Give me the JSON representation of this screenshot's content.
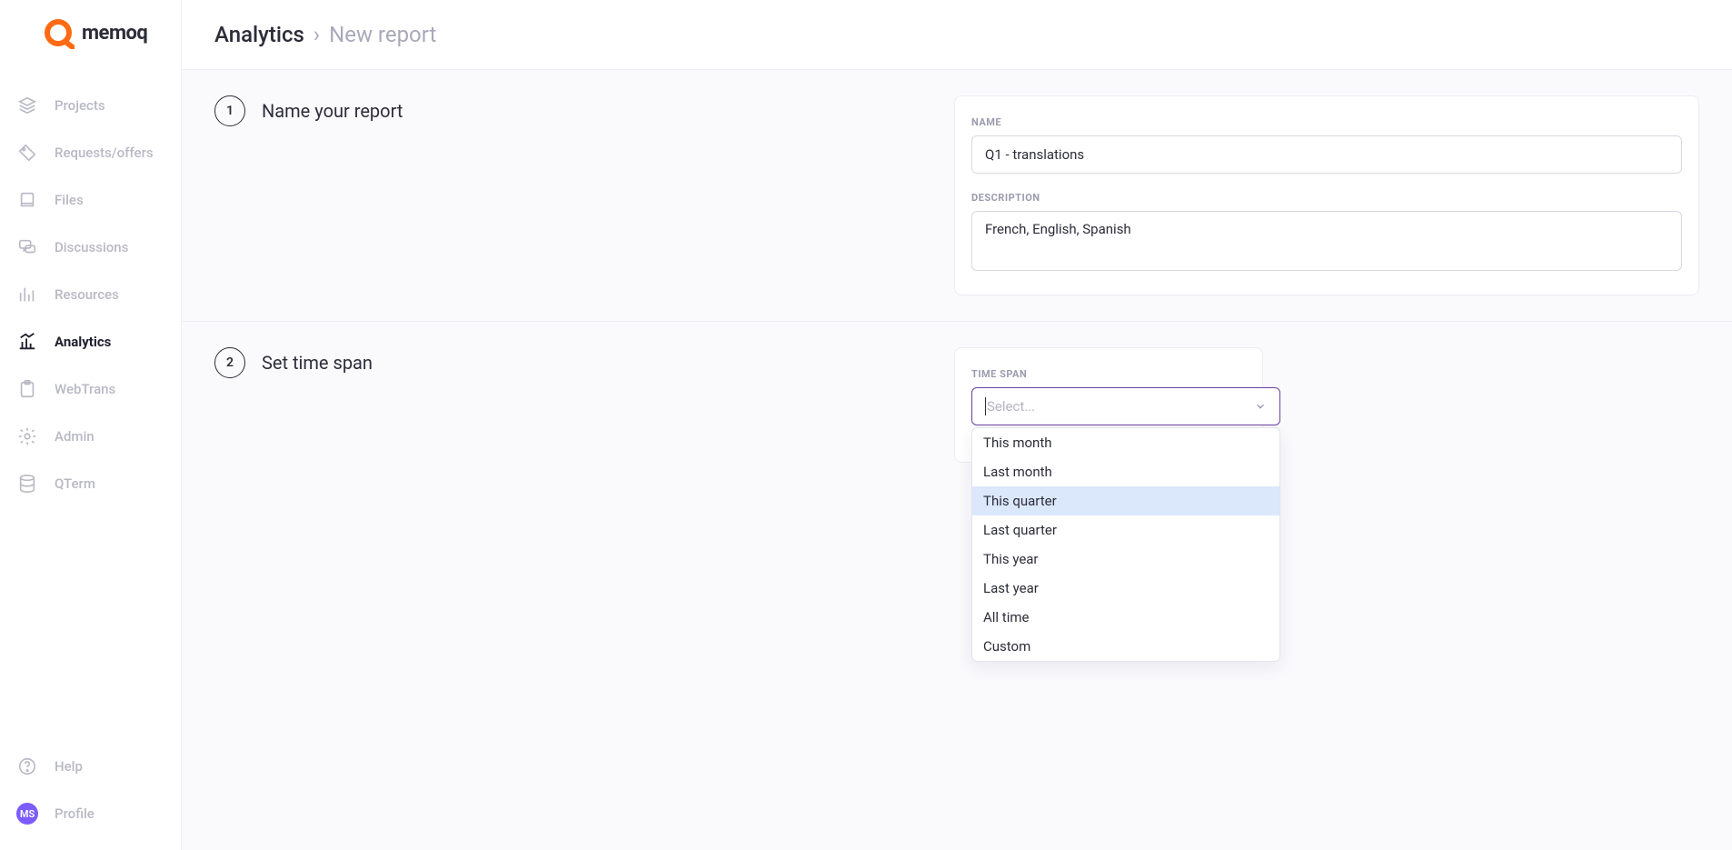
{
  "brand": "memoq",
  "breadcrumb": {
    "root": "Analytics",
    "sep": "›",
    "current": "New report"
  },
  "sidebar": {
    "items": [
      {
        "label": "Projects",
        "icon": "stack"
      },
      {
        "label": "Requests/offers",
        "icon": "tag"
      },
      {
        "label": "Files",
        "icon": "folders"
      },
      {
        "label": "Discussions",
        "icon": "chat"
      },
      {
        "label": "Resources",
        "icon": "bars"
      },
      {
        "label": "Analytics",
        "icon": "chart",
        "active": true
      },
      {
        "label": "WebTrans",
        "icon": "clipboard"
      },
      {
        "label": "Admin",
        "icon": "gear"
      },
      {
        "label": "QTerm",
        "icon": "db"
      }
    ],
    "footer": [
      {
        "label": "Help",
        "icon": "help"
      },
      {
        "label": "Profile",
        "icon": "avatar",
        "initials": "MS"
      }
    ]
  },
  "steps": {
    "s1": {
      "num": "1",
      "title": "Name your report"
    },
    "s2": {
      "num": "2",
      "title": "Set time span"
    }
  },
  "form": {
    "name_label": "NAME",
    "name_value": "Q1 - translations",
    "desc_label": "DESCRIPTION",
    "desc_value": "French, English, Spanish",
    "timespan_label": "TIME SPAN",
    "timespan_placeholder": "Select..."
  },
  "timespan_options": [
    "This month",
    "Last month",
    "This quarter",
    "Last quarter",
    "This year",
    "Last year",
    "All time",
    "Custom"
  ],
  "timespan_highlight_index": 2
}
